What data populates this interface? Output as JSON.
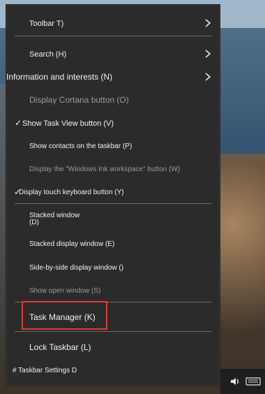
{
  "menu": {
    "items": [
      {
        "label": "Toolbar T)",
        "has_submenu": true
      },
      {
        "label": "Search (H)",
        "has_submenu": true
      },
      {
        "label": "Information and interests (N)",
        "has_submenu": true
      },
      {
        "label": "Display Cortana button (O)"
      },
      {
        "label": "Show Task View button (V)",
        "checked": true
      },
      {
        "label": "Show contacts on the taskbar (P)"
      },
      {
        "label": "Display the \"Windows Ink workspace\" button (W)"
      },
      {
        "label": "Display touch keyboard button (Y)",
        "checked": true
      },
      {
        "label_line1": "Stacked window",
        "label_line2": "(D)"
      },
      {
        "label": "Stacked display window (E)"
      },
      {
        "label": "Side-by-side display window ()"
      },
      {
        "label": "Show open window (S)",
        "dim": true
      },
      {
        "label": "Task Manager (K)",
        "highlighted": true
      },
      {
        "label": "Lock Taskbar (L)"
      },
      {
        "label": "# Taskbar Settings D"
      }
    ],
    "checkmark": "✓"
  },
  "colors": {
    "menu_bg": "#2b2b2b",
    "text": "#f1f1f1",
    "separator": "#6a6a6a",
    "highlight": "#e53b3b"
  },
  "taskbar": {
    "icons": [
      "speaker-icon",
      "keyboard-icon"
    ]
  }
}
